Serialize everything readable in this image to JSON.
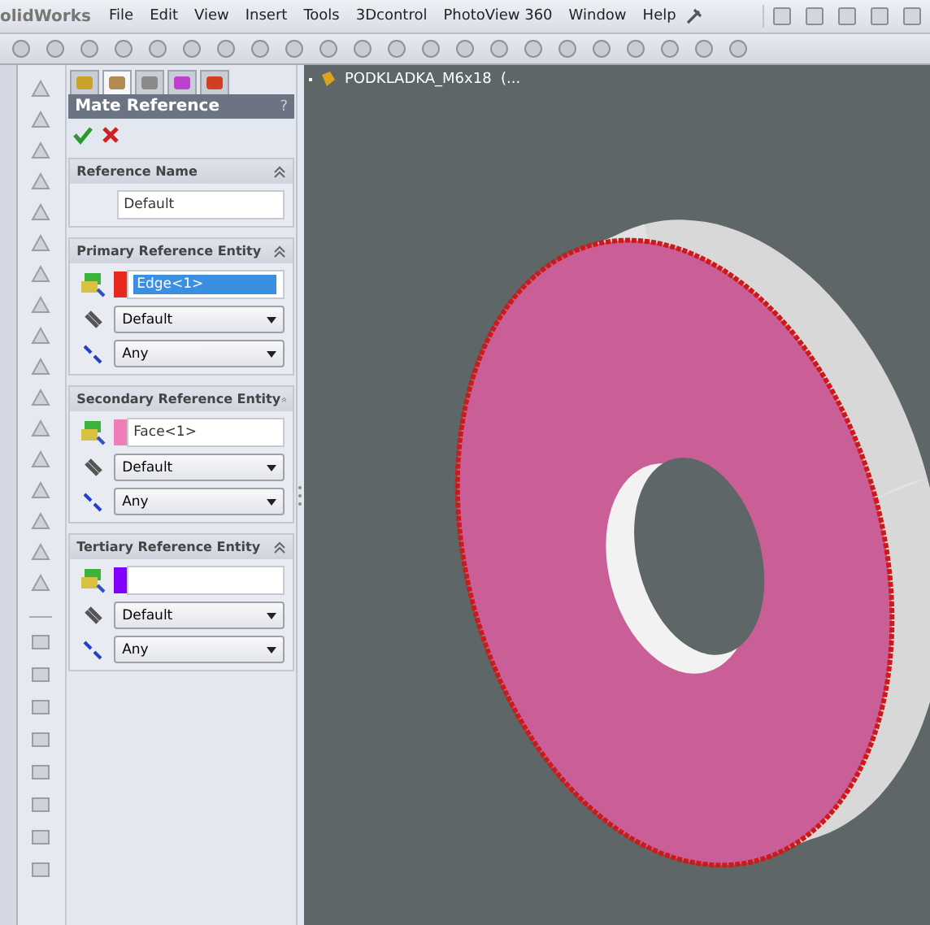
{
  "app_title": "olidWorks",
  "menu": [
    "File",
    "Edit",
    "View",
    "Insert",
    "Tools",
    "3Dcontrol",
    "PhotoView 360",
    "Window",
    "Help"
  ],
  "panel": {
    "tabs": [
      {
        "selected": false
      },
      {
        "selected": true
      },
      {
        "selected": false
      },
      {
        "selected": false
      },
      {
        "selected": false
      }
    ],
    "title": "Mate Reference",
    "help": "?",
    "sections": [
      {
        "kind": "name",
        "title": "Reference Name",
        "value": "Default"
      },
      {
        "kind": "entity",
        "title": "Primary Reference Entity",
        "entity": {
          "value": "Edge<1>",
          "color": "#e8281e",
          "selected": true
        },
        "options": [
          "Default",
          "Any"
        ]
      },
      {
        "kind": "entity",
        "title": "Secondary Reference Entity",
        "entity": {
          "value": "Face<1>",
          "color": "#f07cb8",
          "selected": false
        },
        "options": [
          "Default",
          "Any"
        ]
      },
      {
        "kind": "entity",
        "title": "Tertiary Reference Entity",
        "entity": {
          "color": "#8000ff"
        },
        "options": [
          "Default",
          "Any"
        ]
      }
    ]
  },
  "viewport": {
    "tree_item": "PODKLADKA_M6x18  (..."
  }
}
